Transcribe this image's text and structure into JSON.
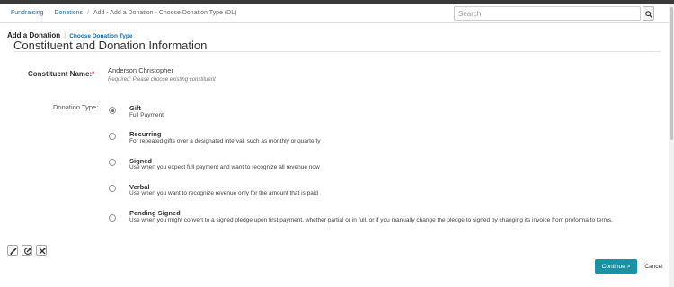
{
  "breadcrumb": {
    "items": [
      "Fundraising",
      "Donations"
    ],
    "current": "Add - Add a Donation - Choose Donation Type (DL)"
  },
  "search": {
    "placeholder": "Search",
    "icon": "search-icon"
  },
  "header": {
    "title": "Add a Donation",
    "subtitle": "Choose Donation Type"
  },
  "section": {
    "title": "Constituent and Donation Information"
  },
  "constituent": {
    "label": "Constituent Name:",
    "required_mark": "*",
    "value": "Anderson Christopher",
    "hint": "Required: Please choose existing constituent"
  },
  "donation_type": {
    "label": "Donation Type:",
    "options": [
      {
        "title": "Gift",
        "description": "Full Payment",
        "selected": true
      },
      {
        "title": "Recurring",
        "description": "For repeated gifts over a designated interval, such as monthly or quarterly",
        "selected": false
      },
      {
        "title": "Signed",
        "description": "Use when you expect full payment and want to recognize all revenue now",
        "selected": false
      },
      {
        "title": "Verbal",
        "description": "Use when you want to recognize revenue only for the amount that is paid",
        "selected": false
      },
      {
        "title": "Pending Signed",
        "description": "Use when you might convert to a signed pledge upon first payment, whether partial or in full, or if you manually change the pledge to signed by changing its invoice from proforma to terms.",
        "selected": false
      }
    ]
  },
  "tools": [
    "edit-icon",
    "edit-circle-icon",
    "settings-tools-icon"
  ],
  "actions": {
    "continue_label": "Continue >",
    "cancel_label": "Cancel"
  },
  "colors": {
    "accent": "#1b91a3",
    "link": "#1a6ea8",
    "required": "#d9534f"
  }
}
